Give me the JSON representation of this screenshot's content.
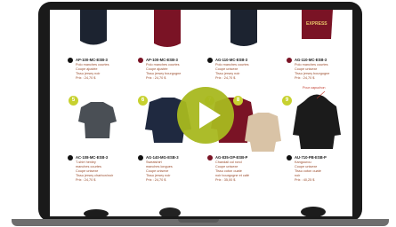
{
  "catalog": {
    "callout": "Pour capuchon",
    "top_items": [
      {
        "code": "AP-100-MC-ESB-3",
        "lines": [
          "Polo manches courtes",
          "Coupe ajustée",
          "Tissu jersey noir"
        ],
        "price": "Prix : 24,70 $",
        "dot": "#111111"
      },
      {
        "code": "AP-100-MC-ESB-3",
        "lines": [
          "Polo manches courtes",
          "Coupe ajustée",
          "Tissu jersey bourgogne"
        ],
        "price": "Prix : 24,70 $",
        "dot": "#7a1325"
      },
      {
        "code": "AG-110-MC-ESB-3",
        "lines": [
          "Polo manches courtes",
          "Coupe unisexe",
          "Tissu jersey noir"
        ],
        "price": "Prix : 24,70 $",
        "dot": "#111111"
      },
      {
        "code": "AG-110-MC-ESB-3",
        "lines": [
          "Polo manches courtes",
          "Coupe unisexe",
          "Tissu jersey bourgogne"
        ],
        "price": "Prix : 24,70 $",
        "dot": "#7a1325"
      }
    ],
    "numbers": [
      "5",
      "6",
      "7",
      "8",
      "9"
    ],
    "bottom_items": [
      {
        "code": "AC-108-MC-ESB-3",
        "lines": [
          "T-shirt henley",
          "manches courtes",
          "Coupe unisexe",
          "Tissu jersey charbon/noir"
        ],
        "price": "Prix : 24,70 $",
        "dot": "#111111"
      },
      {
        "code": "AG-140-MG-ESB-3",
        "lines": [
          "Sweatshirt",
          "manches longues",
          "Coupe unisexe",
          "Tissu jersey noir"
        ],
        "price": "Prix : 24,70 $",
        "dot": "#111111"
      },
      {
        "code": "AG-835-OP-ESB-P",
        "lines": [
          "Chandail col rond",
          "Coupe unisexe",
          "Tissu coton ouaté",
          "noir bourgogne et café"
        ],
        "price": "Prix : 35,00 $",
        "dot": "#7a1325"
      },
      {
        "code": "AU-710-PB-ESB-P",
        "lines": [
          "Kangourou",
          "Coupe unisexe",
          "Tissu coton ouaté",
          "noir"
        ],
        "price": "Prix : 40,25 $",
        "dot": "#111111"
      }
    ],
    "express_label": "EXPRESS"
  },
  "player": {
    "play_icon": "play-icon",
    "accent": "#a8b81f"
  }
}
